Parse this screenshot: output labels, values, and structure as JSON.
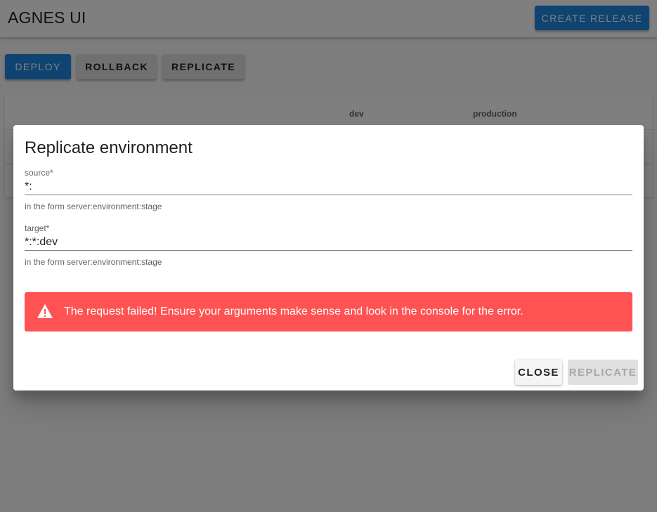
{
  "appbar": {
    "title": "AGNES UI",
    "create_release_label": "CREATE RELEASE"
  },
  "toolbar": {
    "deploy_label": "DEPLOY",
    "rollback_label": "ROLLBACK",
    "replicate_label": "REPLICATE"
  },
  "table": {
    "columns": [
      "",
      "dev",
      "production"
    ]
  },
  "dialog": {
    "title": "Replicate environment",
    "source": {
      "label": "source*",
      "value": "*:",
      "helper": "in the form server:environment:stage"
    },
    "target": {
      "label": "target*",
      "value": "*:*:dev",
      "helper": "in the form server:environment:stage"
    },
    "error": {
      "icon": "warning-icon",
      "message": "The request failed! Ensure your arguments make sense and look in the console for the error."
    },
    "close_label": "CLOSE",
    "replicate_label": "REPLICATE"
  },
  "colors": {
    "primary": "#1e88e5",
    "error": "#ff5252"
  }
}
